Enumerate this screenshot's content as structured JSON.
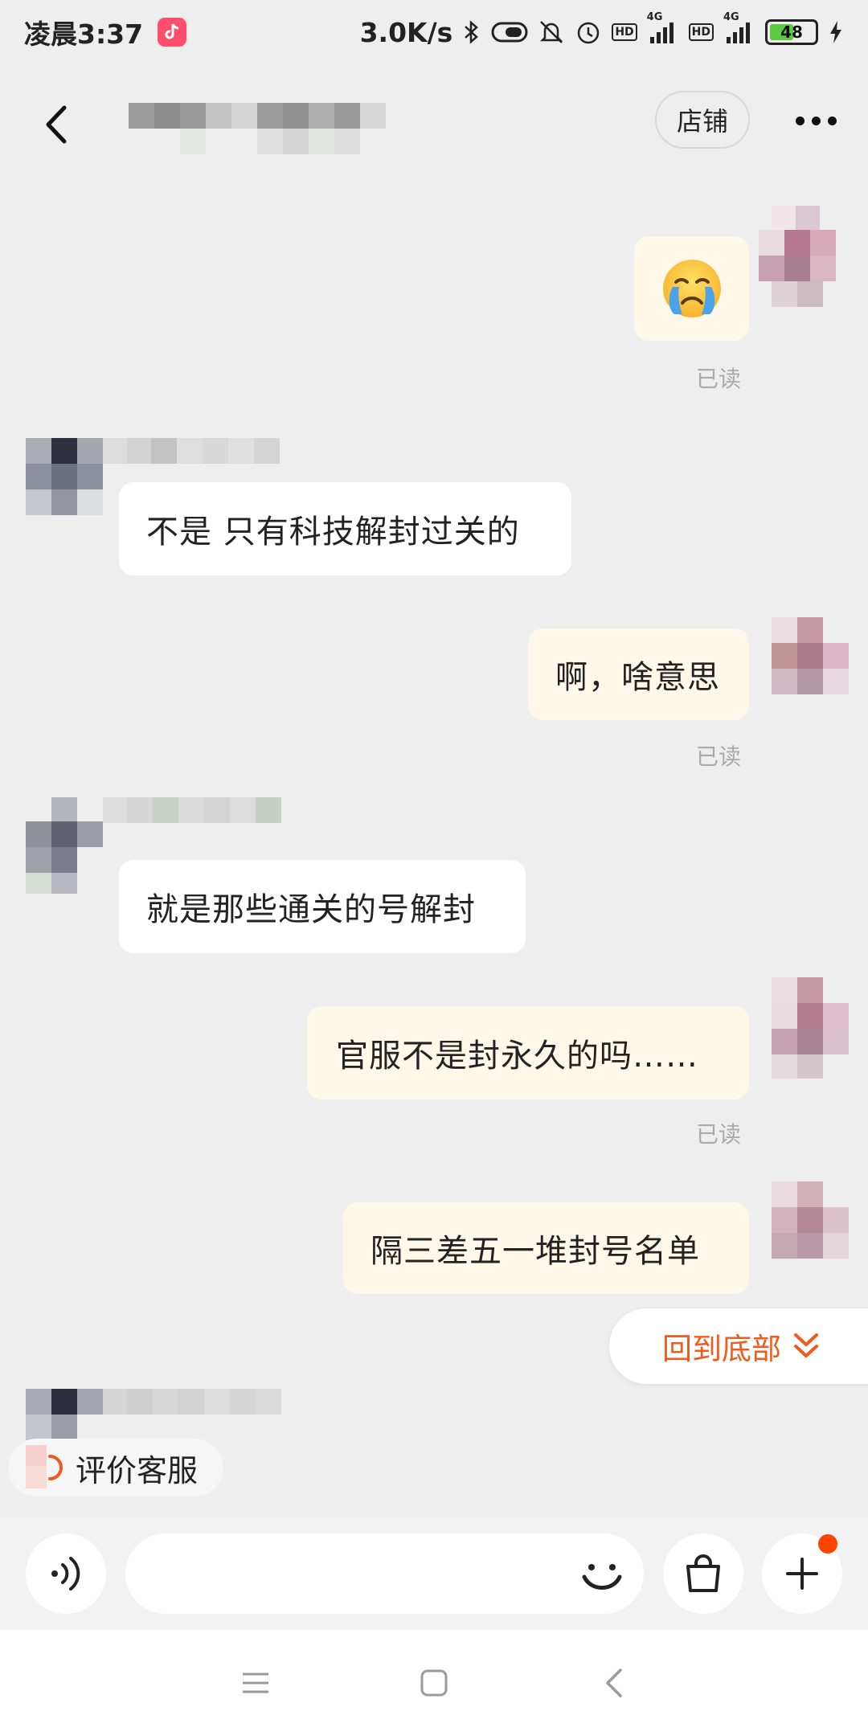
{
  "status": {
    "time": "凌晨3:37",
    "network_speed": "3.0K/s",
    "hd1": "HD",
    "net1": "4G",
    "hd2": "HD",
    "net2": "4G",
    "battery": "48",
    "battery_level": 0.48
  },
  "header": {
    "shop_label": "店铺"
  },
  "messages": [
    {
      "from": "me",
      "type": "emoji",
      "icon": "crying-face-emoji",
      "read_label": "已读"
    },
    {
      "from": "them",
      "text": "不是 只有科技解封过关的"
    },
    {
      "from": "me",
      "text": "啊，啥意思",
      "read_label": "已读"
    },
    {
      "from": "them",
      "text": "就是那些通关的号解封"
    },
    {
      "from": "me",
      "text": "官服不是封永久的吗……",
      "read_label": "已读"
    },
    {
      "from": "me",
      "text": "隔三差五一堆封号名单"
    }
  ],
  "back_to_bottom": {
    "label": "回到底部"
  },
  "eval_chip": {
    "label": "评价客服"
  },
  "input": {
    "placeholder": ""
  },
  "colors": {
    "accent": "#f05a1a",
    "my_bubble": "#fff8e9",
    "their_bubble": "#ffffff",
    "background": "#eeeeee",
    "notification_dot": "#ff4400"
  }
}
